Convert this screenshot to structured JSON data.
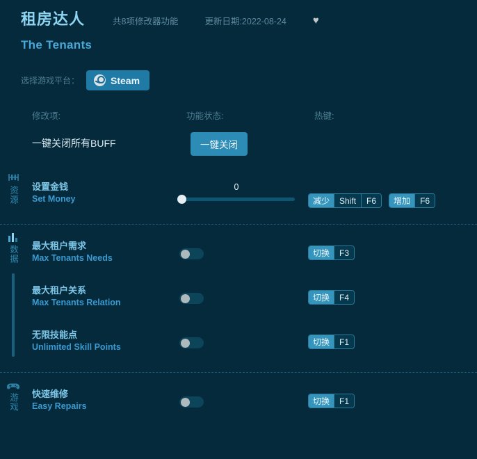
{
  "header": {
    "title_cn": "租房达人",
    "title_en": "The Tenants",
    "feature_count": "共8项修改器功能",
    "update_date": "更新日期:2022-08-24",
    "favorite_icon": "♥",
    "platform_label": "选择游戏平台：",
    "platform_button": "Steam"
  },
  "columns": {
    "modifier": "修改项:",
    "status": "功能状态:",
    "hotkey": "热键:"
  },
  "buff_row": {
    "name": "一键关闭所有BUFF",
    "button": "一键关闭"
  },
  "sections": [
    {
      "id": "resources",
      "label": "资源",
      "icon": "resources-icon",
      "rows": [
        {
          "name_cn": "设置金钱",
          "name_en": "Set Money",
          "control": "slider",
          "value": "0",
          "slider_percent": 0,
          "hotkeys": [
            {
              "action": "减少",
              "keys": [
                "Shift",
                "F6"
              ]
            },
            {
              "action": "增加",
              "keys": [
                "F6"
              ]
            }
          ]
        }
      ]
    },
    {
      "id": "data",
      "label": "数据",
      "icon": "bar-chart-icon",
      "rows": [
        {
          "name_cn": "最大租户需求",
          "name_en": "Max Tenants Needs",
          "control": "toggle",
          "enabled": false,
          "hotkeys": [
            {
              "action": "切换",
              "keys": [
                "F3"
              ]
            }
          ]
        },
        {
          "name_cn": "最大租户关系",
          "name_en": "Max Tenants Relation",
          "control": "toggle",
          "enabled": false,
          "hotkeys": [
            {
              "action": "切换",
              "keys": [
                "F4"
              ]
            }
          ]
        },
        {
          "name_cn": "无限技能点",
          "name_en": "Unlimited Skill Points",
          "control": "toggle",
          "enabled": false,
          "hotkeys": [
            {
              "action": "切换",
              "keys": [
                "F1"
              ]
            }
          ]
        }
      ]
    },
    {
      "id": "game",
      "label": "游戏",
      "icon": "gamepad-icon",
      "rows": [
        {
          "name_cn": "快速维修",
          "name_en": "Easy Repairs",
          "control": "toggle",
          "enabled": false,
          "hotkeys": [
            {
              "action": "切换",
              "keys": [
                "F1"
              ]
            }
          ]
        }
      ]
    }
  ],
  "colors": {
    "background": "#042a3c",
    "accent": "#3595bd",
    "title": "#8fd4f0",
    "subtitle": "#4aa8d8"
  }
}
